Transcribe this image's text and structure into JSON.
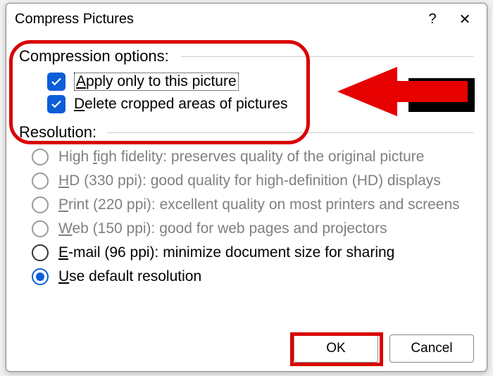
{
  "dialog": {
    "title": "Compress Pictures",
    "help_symbol": "?",
    "close_symbol": "✕"
  },
  "compression": {
    "label": "Compression options:",
    "apply_only": "Apply only to this picture",
    "apply_only_u": "A",
    "delete_cropped": "Delete cropped areas of pictures",
    "delete_cropped_u": "D"
  },
  "resolution": {
    "label": "Resolution:",
    "options": [
      {
        "text": "igh fidelity: preserves quality of the original picture",
        "u": "f",
        "pre": "High ",
        "enabled": false
      },
      {
        "text": "D (330 ppi): good quality for high-definition (HD) displays",
        "u": "H",
        "pre": "",
        "enabled": false
      },
      {
        "text": "rint (220 ppi): excellent quality on most printers and screens",
        "u": "P",
        "pre": "",
        "enabled": false
      },
      {
        "text": "eb (150 ppi): good for web pages and projectors",
        "u": "W",
        "pre": "",
        "enabled": false
      },
      {
        "text": "-mail (96 ppi): minimize document size for sharing",
        "u": "E",
        "pre": "",
        "enabled": true
      },
      {
        "text": "se default resolution",
        "u": "U",
        "pre": "",
        "enabled": true,
        "selected": true
      }
    ]
  },
  "buttons": {
    "ok": "OK",
    "cancel": "Cancel"
  }
}
